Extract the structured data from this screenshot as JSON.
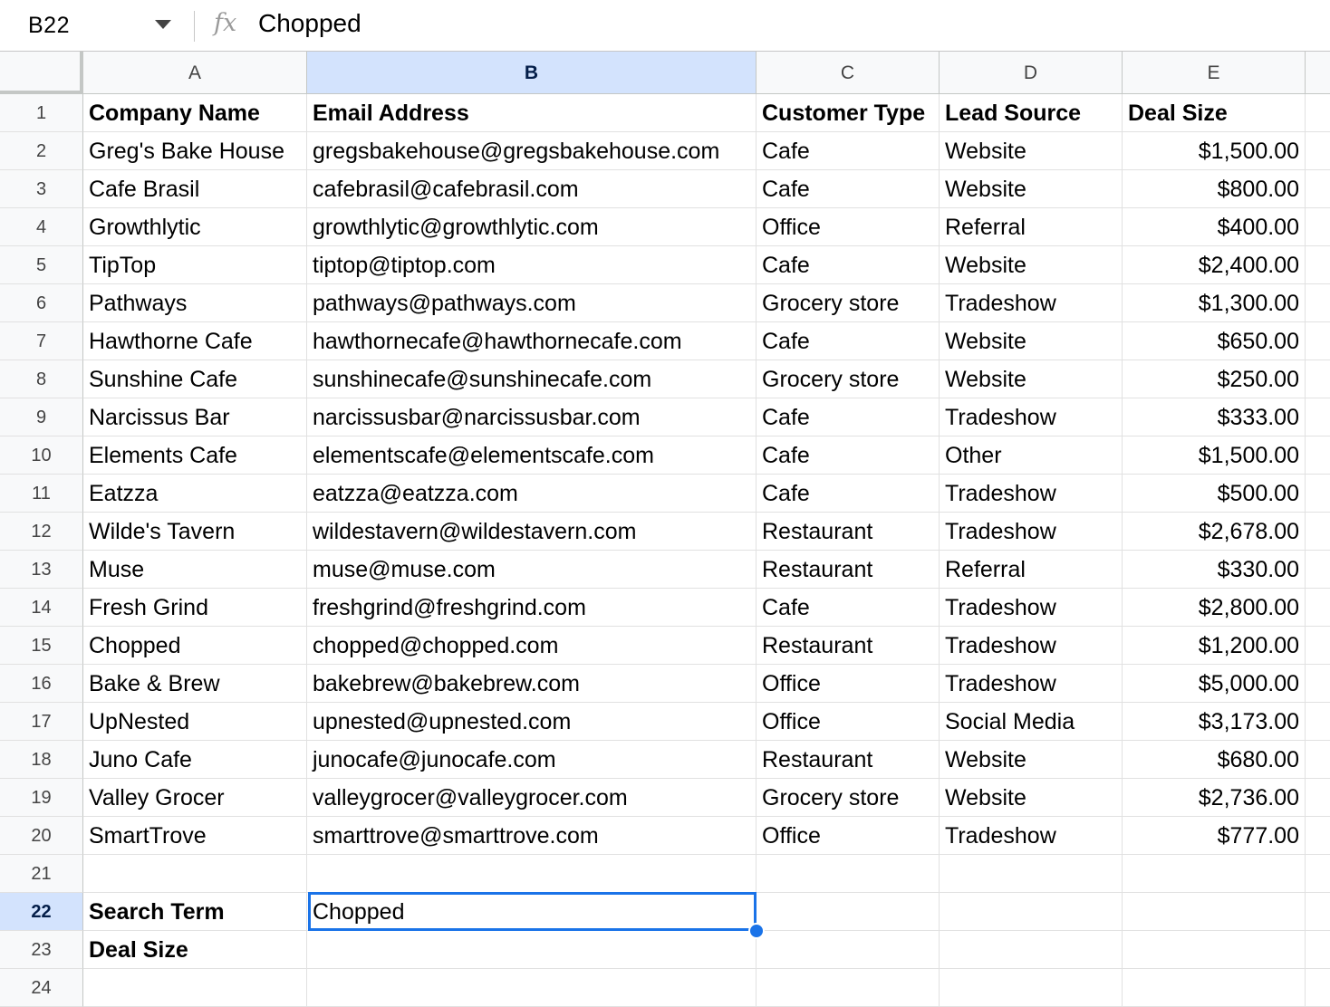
{
  "formula_bar": {
    "cell_ref": "B22",
    "fx_icon": "fx-icon",
    "value": "Chopped"
  },
  "columns": [
    "A",
    "B",
    "C",
    "D",
    "E"
  ],
  "selected": {
    "column": "B",
    "row": 22
  },
  "rows": [
    {
      "num": "1",
      "cells": [
        "Company Name",
        "Email Address",
        "Customer Type",
        "Lead Source",
        "Deal Size"
      ]
    },
    {
      "num": "2",
      "cells": [
        "Greg's Bake House",
        "gregsbakehouse@gregsbakehouse.com",
        "Cafe",
        "Website",
        "$1,500.00"
      ]
    },
    {
      "num": "3",
      "cells": [
        "Cafe Brasil",
        "cafebrasil@cafebrasil.com",
        "Cafe",
        "Website",
        "$800.00"
      ]
    },
    {
      "num": "4",
      "cells": [
        "Growthlytic",
        "growthlytic@growthlytic.com",
        "Office",
        "Referral",
        "$400.00"
      ]
    },
    {
      "num": "5",
      "cells": [
        "TipTop",
        "tiptop@tiptop.com",
        "Cafe",
        "Website",
        "$2,400.00"
      ]
    },
    {
      "num": "6",
      "cells": [
        "Pathways",
        "pathways@pathways.com",
        "Grocery store",
        "Tradeshow",
        "$1,300.00"
      ]
    },
    {
      "num": "7",
      "cells": [
        "Hawthorne Cafe",
        "hawthornecafe@hawthornecafe.com",
        "Cafe",
        "Website",
        "$650.00"
      ]
    },
    {
      "num": "8",
      "cells": [
        "Sunshine Cafe",
        "sunshinecafe@sunshinecafe.com",
        "Grocery store",
        "Website",
        "$250.00"
      ]
    },
    {
      "num": "9",
      "cells": [
        "Narcissus Bar",
        "narcissusbar@narcissusbar.com",
        "Cafe",
        "Tradeshow",
        "$333.00"
      ]
    },
    {
      "num": "10",
      "cells": [
        "Elements Cafe",
        "elementscafe@elementscafe.com",
        "Cafe",
        "Other",
        "$1,500.00"
      ]
    },
    {
      "num": "11",
      "cells": [
        "Eatzza",
        "eatzza@eatzza.com",
        "Cafe",
        "Tradeshow",
        "$500.00"
      ]
    },
    {
      "num": "12",
      "cells": [
        "Wilde's Tavern",
        "wildestavern@wildestavern.com",
        "Restaurant",
        "Tradeshow",
        "$2,678.00"
      ]
    },
    {
      "num": "13",
      "cells": [
        "Muse",
        "muse@muse.com",
        "Restaurant",
        "Referral",
        "$330.00"
      ]
    },
    {
      "num": "14",
      "cells": [
        "Fresh Grind",
        "freshgrind@freshgrind.com",
        "Cafe",
        "Tradeshow",
        "$2,800.00"
      ]
    },
    {
      "num": "15",
      "cells": [
        "Chopped",
        "chopped@chopped.com",
        "Restaurant",
        "Tradeshow",
        "$1,200.00"
      ]
    },
    {
      "num": "16",
      "cells": [
        "Bake & Brew",
        "bakebrew@bakebrew.com",
        "Office",
        "Tradeshow",
        "$5,000.00"
      ]
    },
    {
      "num": "17",
      "cells": [
        "UpNested",
        "upnested@upnested.com",
        "Office",
        "Social Media",
        "$3,173.00"
      ]
    },
    {
      "num": "18",
      "cells": [
        "Juno Cafe",
        "junocafe@junocafe.com",
        "Restaurant",
        "Website",
        "$680.00"
      ]
    },
    {
      "num": "19",
      "cells": [
        "Valley Grocer",
        "valleygrocer@valleygrocer.com",
        "Grocery store",
        "Website",
        "$2,736.00"
      ]
    },
    {
      "num": "20",
      "cells": [
        "SmartTrove",
        "smarttrove@smarttrove.com",
        "Office",
        "Tradeshow",
        "$777.00"
      ]
    },
    {
      "num": "21",
      "cells": [
        "",
        "",
        "",
        "",
        ""
      ]
    },
    {
      "num": "22",
      "cells": [
        "Search Term",
        "Chopped",
        "",
        "",
        ""
      ]
    },
    {
      "num": "23",
      "cells": [
        "Deal Size",
        "",
        "",
        "",
        ""
      ]
    },
    {
      "num": "24",
      "cells": [
        "",
        "",
        "",
        "",
        ""
      ]
    }
  ],
  "bold_cells": [
    "1:A",
    "1:B",
    "1:C",
    "1:D",
    "1:E",
    "22:A",
    "23:A"
  ],
  "numeric_column": "E",
  "colors": {
    "selection": "#1a73e8",
    "header_selected": "#d3e3fd",
    "grid_line": "#e1e1e1"
  }
}
